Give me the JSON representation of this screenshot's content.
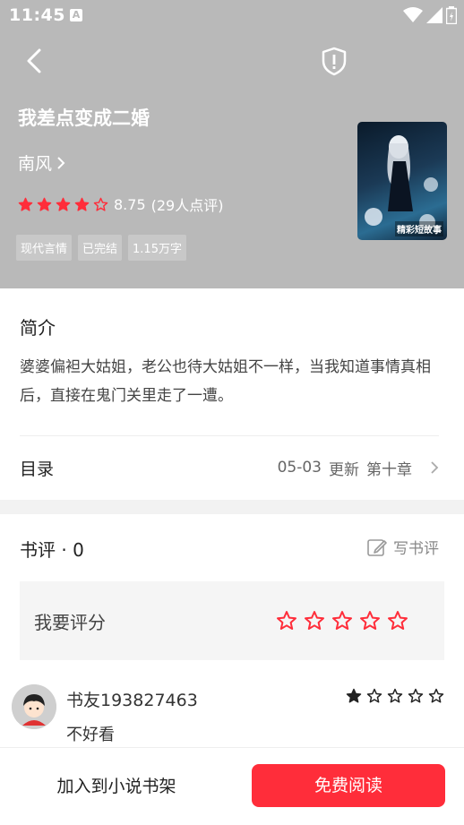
{
  "status_bar": {
    "time": "11:45",
    "notification_glyph": "A",
    "icons": [
      "wifi-icon",
      "signal-icon",
      "battery-icon"
    ]
  },
  "header": {
    "title": "我差点变成二婚",
    "author": "南风",
    "rating_score": "8.75",
    "rating_count": "(29人点评)",
    "stars_filled": 4,
    "stars_outline": 1,
    "tags": [
      "现代言情",
      "已完结",
      "1.15万字"
    ],
    "cover_text": "精彩短故事"
  },
  "intro": {
    "title": "简介",
    "text": "婆婆偏袒大姑姐，老公也待大姑姐不一样，当我知道事情真相后，直接在鬼门关里走了一遭。"
  },
  "toc": {
    "label": "目录",
    "date": "05-03",
    "update": "更新",
    "chapter": "第十章"
  },
  "reviews": {
    "title": "书评 · 0",
    "write_label": "写书评",
    "rate_label": "我要评分",
    "rate_stars": 5
  },
  "comment": {
    "user": "书友193827463",
    "text": "不好看",
    "stars_filled": 1,
    "stars_total": 5
  },
  "bottom": {
    "shelf_label": "加入到小说书架",
    "read_label": "免费阅读"
  },
  "colors": {
    "accent": "#ff2d3a",
    "header_bg": "#b9b9b9"
  }
}
